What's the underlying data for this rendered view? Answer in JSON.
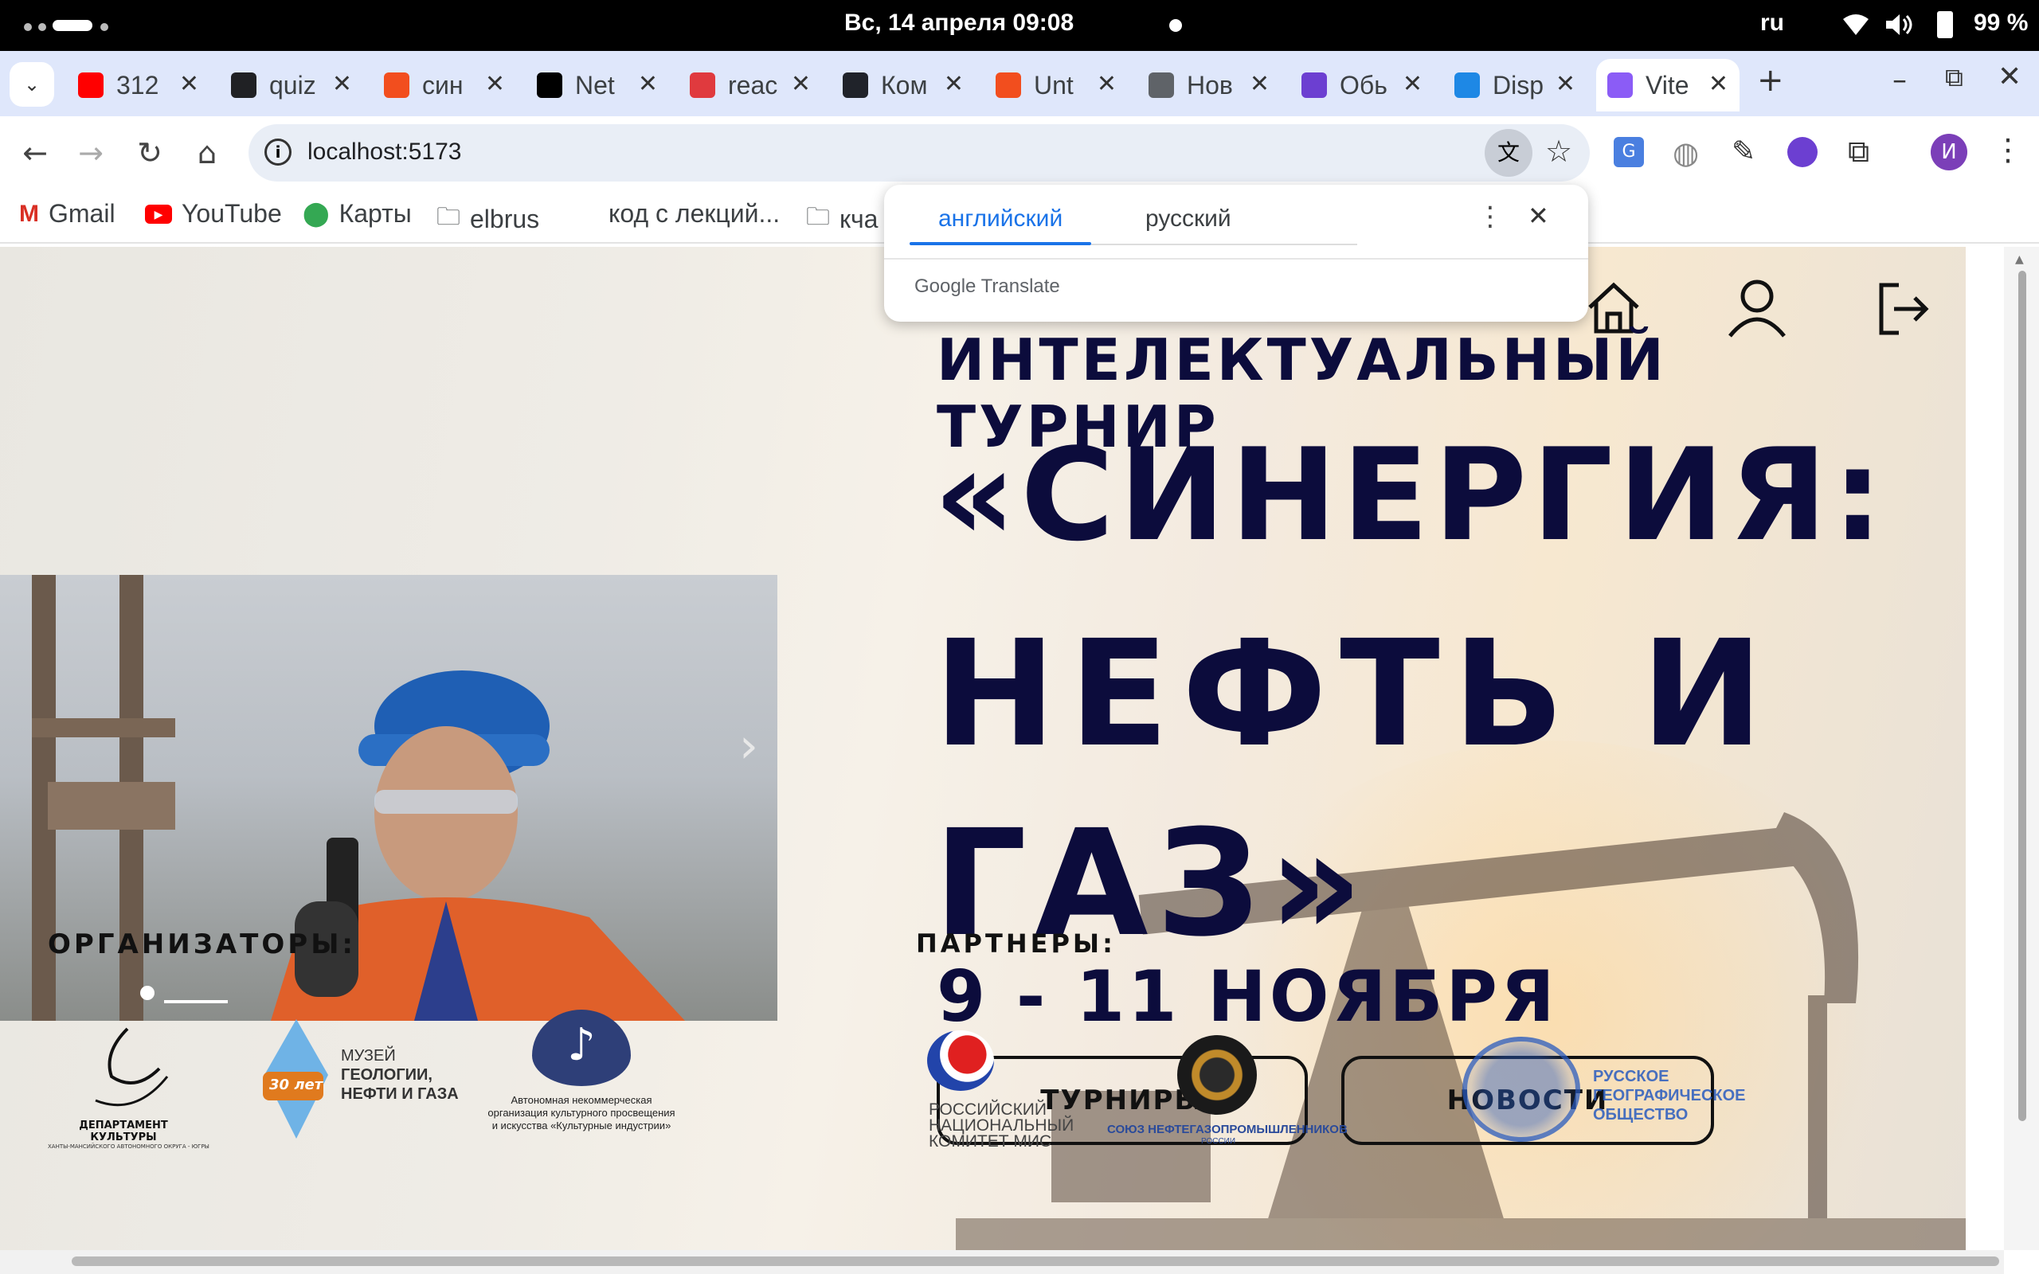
{
  "status_bar": {
    "datetime": "Вс, 14 апреля  09:08",
    "lang": "ru",
    "battery": "99 %"
  },
  "tabs": [
    {
      "title": "312",
      "icon": "youtube-icon",
      "color": "#ff0000"
    },
    {
      "title": "quiz",
      "icon": "app-icon",
      "color": "#202124"
    },
    {
      "title": "син",
      "icon": "figma-icon",
      "color": "#f24e1e"
    },
    {
      "title": "Net",
      "icon": "github-icon",
      "color": "#000000"
    },
    {
      "title": "reac",
      "icon": "app-icon",
      "color": "#e03a3e"
    },
    {
      "title": "Ком",
      "icon": "react-icon",
      "color": "#20232a"
    },
    {
      "title": "Unt",
      "icon": "figma-icon",
      "color": "#f24e1e"
    },
    {
      "title": "Нов",
      "icon": "chrome-icon",
      "color": "#5f6368"
    },
    {
      "title": "Обь",
      "icon": "app-icon",
      "color": "#6c3fd1"
    },
    {
      "title": "Disp",
      "icon": "app-icon",
      "color": "#1e88e5"
    },
    {
      "title": "Vite",
      "icon": "vite-icon",
      "color": "#8b5cf6"
    }
  ],
  "omnibox": {
    "url": "localhost:5173"
  },
  "bookmarks": [
    {
      "label": "Gmail",
      "icon": "gmail-icon"
    },
    {
      "label": "YouTube",
      "icon": "youtube-icon"
    },
    {
      "label": "Карты",
      "icon": "maps-icon"
    },
    {
      "label": "elbrus",
      "icon": "folder-icon"
    },
    {
      "label": "код с лекций...",
      "icon": ""
    },
    {
      "label": "кча",
      "icon": "folder-icon"
    }
  ],
  "translate_popup": {
    "lang_source": "английский",
    "lang_target": "русский",
    "brand": "Google Translate"
  },
  "profile_initial": "И",
  "hero": {
    "subtitle": "ИНТЕЛЕКТУАЛЬНЫЙ ТУРНИР",
    "title_line1": "«СИНЕРГИЯ:",
    "title_line2": "НЕФТЬ И",
    "title_line3": "ГАЗ»",
    "dates": "9 - 11 НОЯБРЯ",
    "btn_tournaments": "ТУРНИРЫ",
    "btn_news": "НОВОСТИ"
  },
  "organizers": {
    "heading": "ОРГАНИЗАТОРЫ:",
    "dept_name": "ДЕПАРТАМЕНТ КУЛЬТУРЫ",
    "dept_sub": "ХАНТЫ-МАНСИЙСКОГО АВТОНОМНОГО ОКРУГА - ЮГРЫ",
    "museum_line1": "МУЗЕЙ",
    "museum_line2": "ГЕОЛОГИИ,",
    "museum_line3": "НЕФТИ И ГАЗА",
    "museum_badge": "30 лет",
    "ano_line1": "Автономная некоммерческая",
    "ano_line2": "организация культурного просвещения",
    "ano_line3": "и искусства «Культурные индустрии»"
  },
  "partners": {
    "heading": "ПАРТНЕРЫ:",
    "rnk_line1": "РОССИЙСКИЙ",
    "rnk_line2": "НАЦИОНАЛЬНЫЙ",
    "rnk_line3": "КОМИТЕТ МИС",
    "union": "СОЮЗ НЕФТЕГАЗОПРОМЫШЛЕННИКОВ",
    "union_sub": "РОССИИ",
    "rgo_line1": "РУССКОЕ",
    "rgo_line2": "ГЕОГРАФИЧЕСКОЕ",
    "rgo_line3": "ОБЩЕСТВО"
  },
  "colors": {
    "title": "#0c0c3c",
    "accent_blue": "#1a73e8"
  }
}
